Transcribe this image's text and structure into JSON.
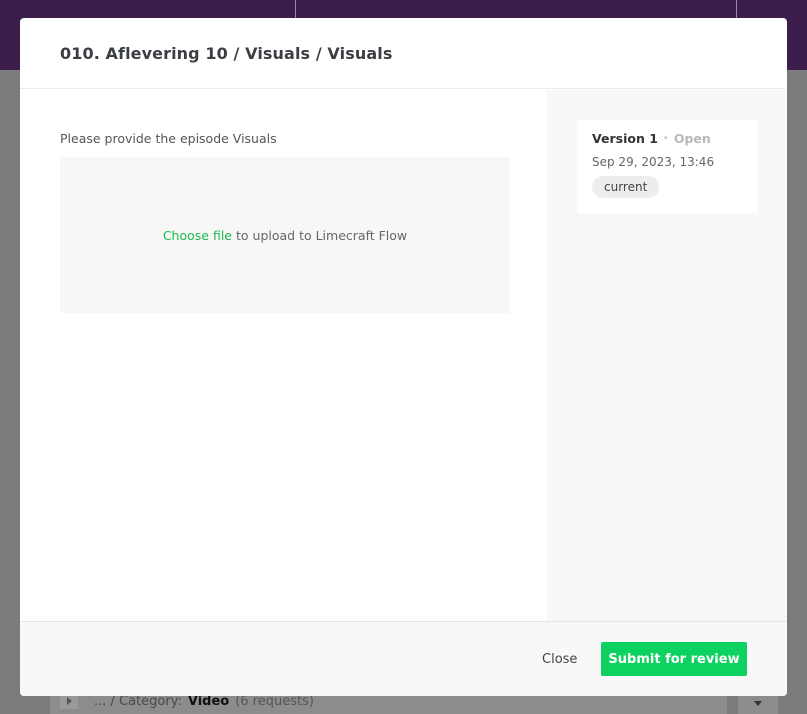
{
  "background": {
    "breadcrumb_prefix": "... / Category:",
    "category_value": "Video",
    "request_count": "(6 requests)"
  },
  "modal": {
    "title": "010. Aflevering 10 / Visuals / Visuals",
    "prompt": "Please provide the episode Visuals",
    "upload": {
      "choose_label": "Choose file",
      "suffix": "to upload to Limecraft Flow"
    },
    "version": {
      "label": "Version 1",
      "separator": "•",
      "status": "Open",
      "date": "Sep 29, 2023, 13:46",
      "badge": "current"
    },
    "footer": {
      "close_label": "Close",
      "submit_label": "Submit for review"
    }
  },
  "colors": {
    "topbar": "#3c1d4b",
    "accent_green": "#0dd25f",
    "link_green": "#1fb94e"
  }
}
